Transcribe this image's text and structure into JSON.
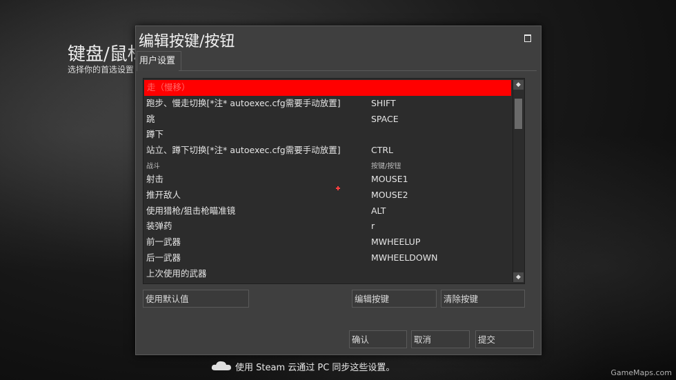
{
  "background": {
    "title": "键盘/鼠标",
    "subtitle": "选择你的首选设置"
  },
  "dialog": {
    "title": "编辑按键/按钮",
    "tab": "用户设置",
    "rows": [
      {
        "action": "走（慢移）",
        "key": "",
        "type": "selected"
      },
      {
        "action": "跑步、慢走切换[*注* autoexec.cfg需要手动放置]",
        "key": "SHIFT",
        "type": "item"
      },
      {
        "action": "跳",
        "key": "SPACE",
        "type": "item"
      },
      {
        "action": "蹲下",
        "key": "",
        "type": "item"
      },
      {
        "action": "站立、蹲下切换[*注* autoexec.cfg需要手动放置]",
        "key": "CTRL",
        "type": "item"
      },
      {
        "action": "战斗",
        "key": "按键/按钮",
        "type": "header"
      },
      {
        "action": "射击",
        "key": "MOUSE1",
        "type": "item"
      },
      {
        "action": "推开敌人",
        "key": "MOUSE2",
        "type": "item"
      },
      {
        "action": "使用猎枪/狙击枪瞄准镜",
        "key": "ALT",
        "type": "item"
      },
      {
        "action": "装弹药",
        "key": "r",
        "type": "item"
      },
      {
        "action": "前一武器",
        "key": "MWHEELUP",
        "type": "item"
      },
      {
        "action": "后一武器",
        "key": "MWHEELDOWN",
        "type": "item"
      },
      {
        "action": "上次使用的武器",
        "key": "",
        "type": "item"
      }
    ],
    "buttons": {
      "defaults": "使用默认值",
      "edit": "编辑按键",
      "clear": "清除按键",
      "ok": "确认",
      "cancel": "取消",
      "apply": "提交"
    }
  },
  "footer": {
    "cloud_text": "使用 Steam 云通过 PC 同步这些设置。",
    "icon": "cloud-icon"
  },
  "watermark": "GameMaps.com",
  "colors": {
    "selection": "#ff0000",
    "dialog_bg": "#3f3f3f",
    "list_bg": "#2c2c2c"
  }
}
